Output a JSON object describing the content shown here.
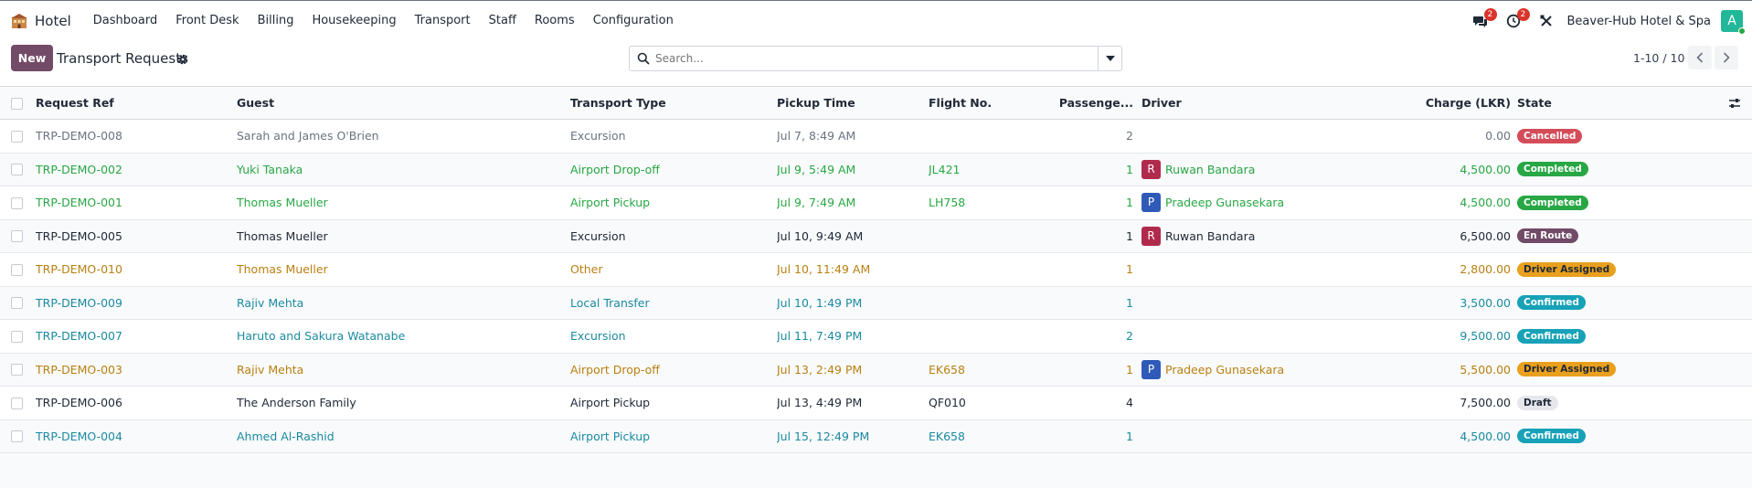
{
  "navbar": {
    "app_name": "Hotel",
    "menu": [
      "Dashboard",
      "Front Desk",
      "Billing",
      "Housekeeping",
      "Transport",
      "Staff",
      "Rooms",
      "Configuration"
    ],
    "messages_badge": "2",
    "activities_badge": "2",
    "company": "Beaver-Hub Hotel & Spa",
    "user_initial": "A"
  },
  "control": {
    "new_label": "New",
    "title": "Transport Requests",
    "search_placeholder": "Search...",
    "pager": "1-10 / 10"
  },
  "columns": {
    "ref": "Request Ref",
    "guest": "Guest",
    "type": "Transport Type",
    "pickup": "Pickup Time",
    "flight": "Flight No.",
    "pax": "Passenge...",
    "driver": "Driver",
    "charge": "Charge (LKR)",
    "state": "State"
  },
  "colors": {
    "brand": "#714b67",
    "cancelled": "#d44c59",
    "completed": "#28a745",
    "en_route": "#714b67",
    "driver_assigned": "#e9a01d",
    "confirmed": "#17a2b8",
    "draft": "#e5e7eb"
  },
  "rows": [
    {
      "ref": "TRP-DEMO-008",
      "guest": "Sarah and James O'Brien",
      "type": "Excursion",
      "pickup": "Jul 7, 8:49 AM",
      "flight": "",
      "pax": "2",
      "driver": "",
      "driver_initial": "",
      "charge": "0.00",
      "state": "Cancelled"
    },
    {
      "ref": "TRP-DEMO-002",
      "guest": "Yuki Tanaka",
      "type": "Airport Drop-off",
      "pickup": "Jul 9, 5:49 AM",
      "flight": "JL421",
      "pax": "1",
      "driver": "Ruwan Bandara",
      "driver_initial": "R",
      "charge": "4,500.00",
      "state": "Completed"
    },
    {
      "ref": "TRP-DEMO-001",
      "guest": "Thomas Mueller",
      "type": "Airport Pickup",
      "pickup": "Jul 9, 7:49 AM",
      "flight": "LH758",
      "pax": "1",
      "driver": "Pradeep Gunasekara",
      "driver_initial": "P",
      "charge": "4,500.00",
      "state": "Completed"
    },
    {
      "ref": "TRP-DEMO-005",
      "guest": "Thomas Mueller",
      "type": "Excursion",
      "pickup": "Jul 10, 9:49 AM",
      "flight": "",
      "pax": "1",
      "driver": "Ruwan Bandara",
      "driver_initial": "R",
      "charge": "6,500.00",
      "state": "En Route"
    },
    {
      "ref": "TRP-DEMO-010",
      "guest": "Thomas Mueller",
      "type": "Other",
      "pickup": "Jul 10, 11:49 AM",
      "flight": "",
      "pax": "1",
      "driver": "",
      "driver_initial": "",
      "charge": "2,800.00",
      "state": "Driver Assigned"
    },
    {
      "ref": "TRP-DEMO-009",
      "guest": "Rajiv Mehta",
      "type": "Local Transfer",
      "pickup": "Jul 10, 1:49 PM",
      "flight": "",
      "pax": "1",
      "driver": "",
      "driver_initial": "",
      "charge": "3,500.00",
      "state": "Confirmed"
    },
    {
      "ref": "TRP-DEMO-007",
      "guest": "Haruto and Sakura Watanabe",
      "type": "Excursion",
      "pickup": "Jul 11, 7:49 PM",
      "flight": "",
      "pax": "2",
      "driver": "",
      "driver_initial": "",
      "charge": "9,500.00",
      "state": "Confirmed"
    },
    {
      "ref": "TRP-DEMO-003",
      "guest": "Rajiv Mehta",
      "type": "Airport Drop-off",
      "pickup": "Jul 13, 2:49 PM",
      "flight": "EK658",
      "pax": "1",
      "driver": "Pradeep Gunasekara",
      "driver_initial": "P",
      "charge": "5,500.00",
      "state": "Driver Assigned"
    },
    {
      "ref": "TRP-DEMO-006",
      "guest": "The Anderson Family",
      "type": "Airport Pickup",
      "pickup": "Jul 13, 4:49 PM",
      "flight": "QF010",
      "pax": "4",
      "driver": "",
      "driver_initial": "",
      "charge": "7,500.00",
      "state": "Draft"
    },
    {
      "ref": "TRP-DEMO-004",
      "guest": "Ahmed Al-Rashid",
      "type": "Airport Pickup",
      "pickup": "Jul 15, 12:49 PM",
      "flight": "EK658",
      "pax": "1",
      "driver": "",
      "driver_initial": "",
      "charge": "4,500.00",
      "state": "Confirmed"
    }
  ]
}
